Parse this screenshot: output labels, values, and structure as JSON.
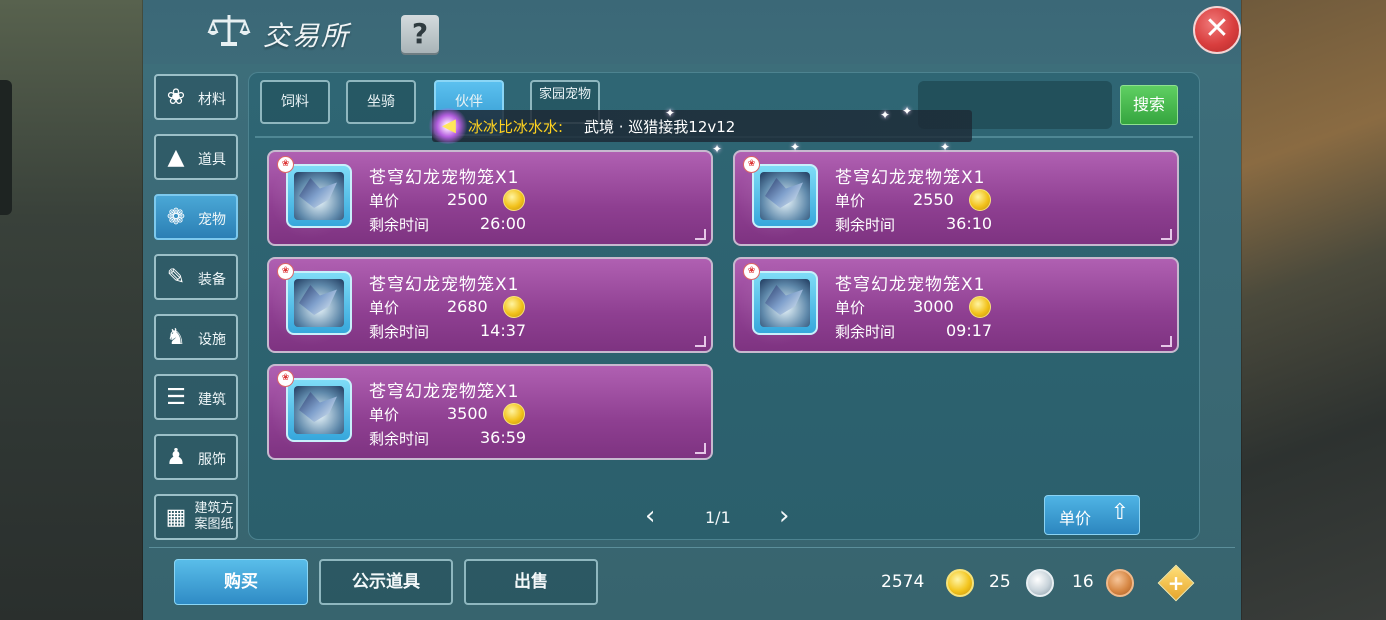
{
  "window": {
    "title": "交易所",
    "help_label": "?",
    "close_label": "✕"
  },
  "sidebar": {
    "items": [
      {
        "label": "材料",
        "icon": "materials-icon",
        "glyph": "❀",
        "active": false
      },
      {
        "label": "道具",
        "icon": "potion-icon",
        "glyph": "▲",
        "active": false
      },
      {
        "label": "宠物",
        "icon": "paw-icon",
        "glyph": "❁",
        "active": true
      },
      {
        "label": "装备",
        "icon": "equipment-icon",
        "glyph": "✎",
        "active": false
      },
      {
        "label": "设施",
        "icon": "facility-icon",
        "glyph": "♞",
        "active": false
      },
      {
        "label": "建筑",
        "icon": "building-icon",
        "glyph": "☰",
        "active": false
      },
      {
        "label": "服饰",
        "icon": "clothing-icon",
        "glyph": "♟",
        "active": false
      },
      {
        "label": "建筑方案图纸",
        "icon": "blueprint-icon",
        "glyph": "▦",
        "active": false
      }
    ]
  },
  "tabs": [
    {
      "label": "饲料",
      "active": false
    },
    {
      "label": "坐骑",
      "active": false
    },
    {
      "label": "伙伴",
      "active": true
    },
    {
      "label": "家园宠物",
      "active": false
    }
  ],
  "search": {
    "value": "",
    "button_label": "搜索"
  },
  "broadcast": {
    "sender": "冰冰比冰水水:",
    "message": "武境 · 巡猎接我12v12"
  },
  "listing_labels": {
    "price": "单价",
    "time": "剩余时间"
  },
  "listings": [
    {
      "name": "苍穹幻龙宠物笼X1",
      "price": "2500",
      "time": "26:00"
    },
    {
      "name": "苍穹幻龙宠物笼X1",
      "price": "2550",
      "time": "36:10"
    },
    {
      "name": "苍穹幻龙宠物笼X1",
      "price": "2680",
      "time": "14:37"
    },
    {
      "name": "苍穹幻龙宠物笼X1",
      "price": "3000",
      "time": "09:17"
    },
    {
      "name": "苍穹幻龙宠物笼X1",
      "price": "3500",
      "time": "36:59"
    }
  ],
  "pager": {
    "text": "1/1",
    "prev": "‹",
    "next": "›"
  },
  "sort": {
    "label": "单价",
    "direction": "up"
  },
  "bottom": {
    "buy_label": "购买",
    "showcase_label": "公示道具",
    "sell_label": "出售"
  },
  "currency": {
    "gold": "2574",
    "silver": "25",
    "bronze": "16"
  },
  "colors": {
    "accent": "#2f95cc",
    "card": "#8e3f91",
    "search_button": "#35a53f"
  }
}
